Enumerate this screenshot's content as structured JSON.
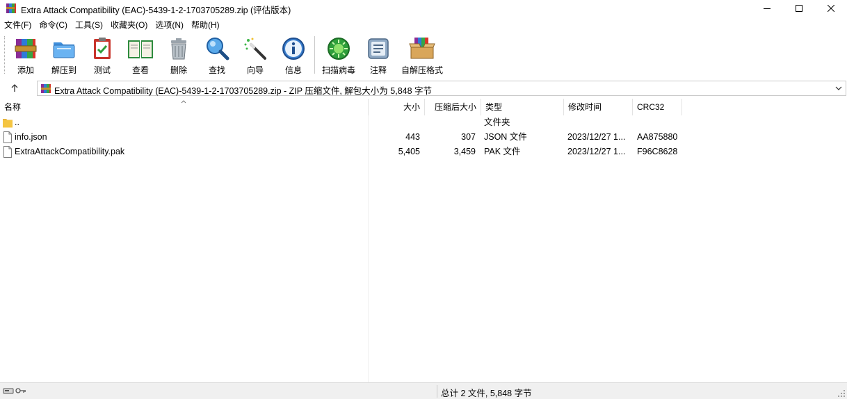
{
  "window": {
    "title": "Extra Attack Compatibility (EAC)-5439-1-2-1703705289.zip (评估版本)",
    "controls": [
      "minimize",
      "maximize",
      "close"
    ]
  },
  "menu": [
    {
      "label": "文件(F)"
    },
    {
      "label": "命令(C)"
    },
    {
      "label": "工具(S)"
    },
    {
      "label": "收藏夹(O)"
    },
    {
      "label": "选项(N)"
    },
    {
      "label": "帮助(H)"
    }
  ],
  "toolbar": {
    "buttons": [
      {
        "label": "添加",
        "icon": "add-archive-icon"
      },
      {
        "label": "解压到",
        "icon": "extract-folder-icon"
      },
      {
        "label": "测试",
        "icon": "test-clipboard-icon"
      },
      {
        "label": "查看",
        "icon": "view-book-icon"
      },
      {
        "label": "删除",
        "icon": "delete-trash-icon"
      },
      {
        "label": "查找",
        "icon": "find-magnifier-icon"
      },
      {
        "label": "向导",
        "icon": "wizard-wand-icon"
      },
      {
        "label": "信息",
        "icon": "info-icon"
      },
      {
        "label": "扫描病毒",
        "icon": "virus-scan-icon"
      },
      {
        "label": "注释",
        "icon": "comment-icon"
      },
      {
        "label": "自解压格式",
        "icon": "sfx-box-icon"
      }
    ]
  },
  "address": {
    "path": "Extra Attack Compatibility (EAC)-5439-1-2-1703705289.zip - ZIP 压缩文件, 解包大小为 5,848 字节"
  },
  "columns": {
    "name": "名称",
    "size": "大小",
    "packed": "压缩后大小",
    "type": "类型",
    "modified": "修改时间",
    "crc": "CRC32"
  },
  "files": [
    {
      "name": "..",
      "size": "",
      "packed": "",
      "type": "文件夹",
      "modified": "",
      "crc": "",
      "icon": "folder-icon"
    },
    {
      "name": "info.json",
      "size": "443",
      "packed": "307",
      "type": "JSON 文件",
      "modified": "2023/12/27 1...",
      "crc": "AA875880",
      "icon": "file-icon"
    },
    {
      "name": "ExtraAttackCompatibility.pak",
      "size": "5,405",
      "packed": "3,459",
      "type": "PAK 文件",
      "modified": "2023/12/27 1...",
      "crc": "F96C8628",
      "icon": "file-icon"
    }
  ],
  "status": {
    "summary": "总计 2 文件, 5,848 字节"
  },
  "colors": {
    "accent_green": "#2e9e3a",
    "folder_yellow": "#f4c542"
  }
}
